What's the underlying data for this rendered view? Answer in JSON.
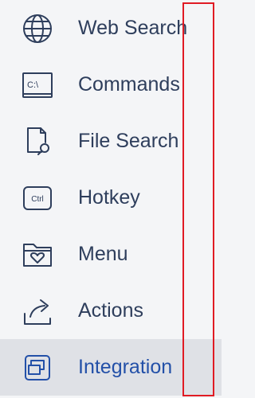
{
  "sidebar": {
    "items": [
      {
        "label": "Web Search",
        "icon": "globe-icon",
        "active": false
      },
      {
        "label": "Commands",
        "icon": "terminal-icon",
        "active": false
      },
      {
        "label": "File Search",
        "icon": "file-search-icon",
        "active": false
      },
      {
        "label": "Hotkey",
        "icon": "ctrl-key-icon",
        "active": false
      },
      {
        "label": "Menu",
        "icon": "folder-heart-icon",
        "active": false
      },
      {
        "label": "Actions",
        "icon": "share-arrow-icon",
        "active": false
      },
      {
        "label": "Integration",
        "icon": "windows-stack-icon",
        "active": true
      }
    ]
  },
  "icon_text": {
    "commands": "C:\\",
    "hotkey": "Ctrl"
  },
  "colors": {
    "text": "#2e3e5c",
    "active_text": "#2350a8",
    "active_background": "#dfe1e6",
    "background": "#f4f5f7",
    "annotation_border": "#e01b24"
  }
}
